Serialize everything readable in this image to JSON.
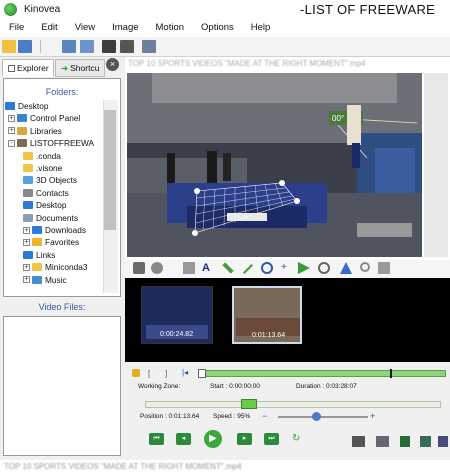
{
  "window": {
    "title": "Kinovea",
    "watermark": "-LIST OF FREEWARE"
  },
  "menu": [
    "File",
    "Edit",
    "View",
    "Image",
    "Motion",
    "Options",
    "Help"
  ],
  "left_panel": {
    "tabs": [
      "Explorer",
      "Shortcu"
    ],
    "folders_label": "Folders:",
    "tree": [
      {
        "label": "Desktop",
        "level": 0,
        "exp": "",
        "color": "#2b7bd6"
      },
      {
        "label": "Control Panel",
        "level": 1,
        "exp": "+",
        "color": "#3a86c8"
      },
      {
        "label": "Libraries",
        "level": 1,
        "exp": "+",
        "color": "#d9a63a"
      },
      {
        "label": "LISTOFFREEWA",
        "level": 1,
        "exp": "-",
        "color": "#7a6a52"
      },
      {
        "label": ".conda",
        "level": 2,
        "exp": "",
        "color": "#f0c64a"
      },
      {
        "label": ".visone",
        "level": 2,
        "exp": "",
        "color": "#f0c64a"
      },
      {
        "label": "3D Objects",
        "level": 2,
        "exp": "",
        "color": "#5aa0e0"
      },
      {
        "label": "Contacts",
        "level": 2,
        "exp": "",
        "color": "#8a8a8a"
      },
      {
        "label": "Desktop",
        "level": 2,
        "exp": "",
        "color": "#2b7bd6"
      },
      {
        "label": "Documents",
        "level": 2,
        "exp": "",
        "color": "#8aa0b8"
      },
      {
        "label": "Downloads",
        "level": 2,
        "exp": "+",
        "color": "#2b7bd6"
      },
      {
        "label": "Favorites",
        "level": 2,
        "exp": "+",
        "color": "#f0b428"
      },
      {
        "label": "Links",
        "level": 2,
        "exp": "",
        "color": "#2b7bd6"
      },
      {
        "label": "Miniconda3",
        "level": 2,
        "exp": "+",
        "color": "#f0c64a"
      },
      {
        "label": "Music",
        "level": 2,
        "exp": "+",
        "color": "#4a8ad0"
      }
    ],
    "video_files_label": "Video Files:"
  },
  "viewer": {
    "file_title": "TOP 10 SPORTS VIDEOS \"MADE AT THE RIGHT MOMENT\".mp4",
    "angle_label": "00°"
  },
  "thumbnails": [
    {
      "time": "0:00:24.82"
    },
    {
      "time": "0:01:13.64"
    }
  ],
  "playback": {
    "working_zone_label": "Working Zone:",
    "start_label": "Start : 0:00:00:00",
    "duration_label": "Duration : 0:03:28:07",
    "position_label": "Position : 0:01:13.64",
    "speed_label": "Speed : 95%",
    "position_fraction": 0.35,
    "speed_fraction": 0.42
  },
  "bottom_watermark": "TOP 10 SPORTS VIDEOS \"MADE AT THE RIGHT MOMENT\".mp4",
  "colors": {
    "accent": "#2b7bd6",
    "green": "#4cc94c",
    "label_blue": "#3a5a9a"
  }
}
